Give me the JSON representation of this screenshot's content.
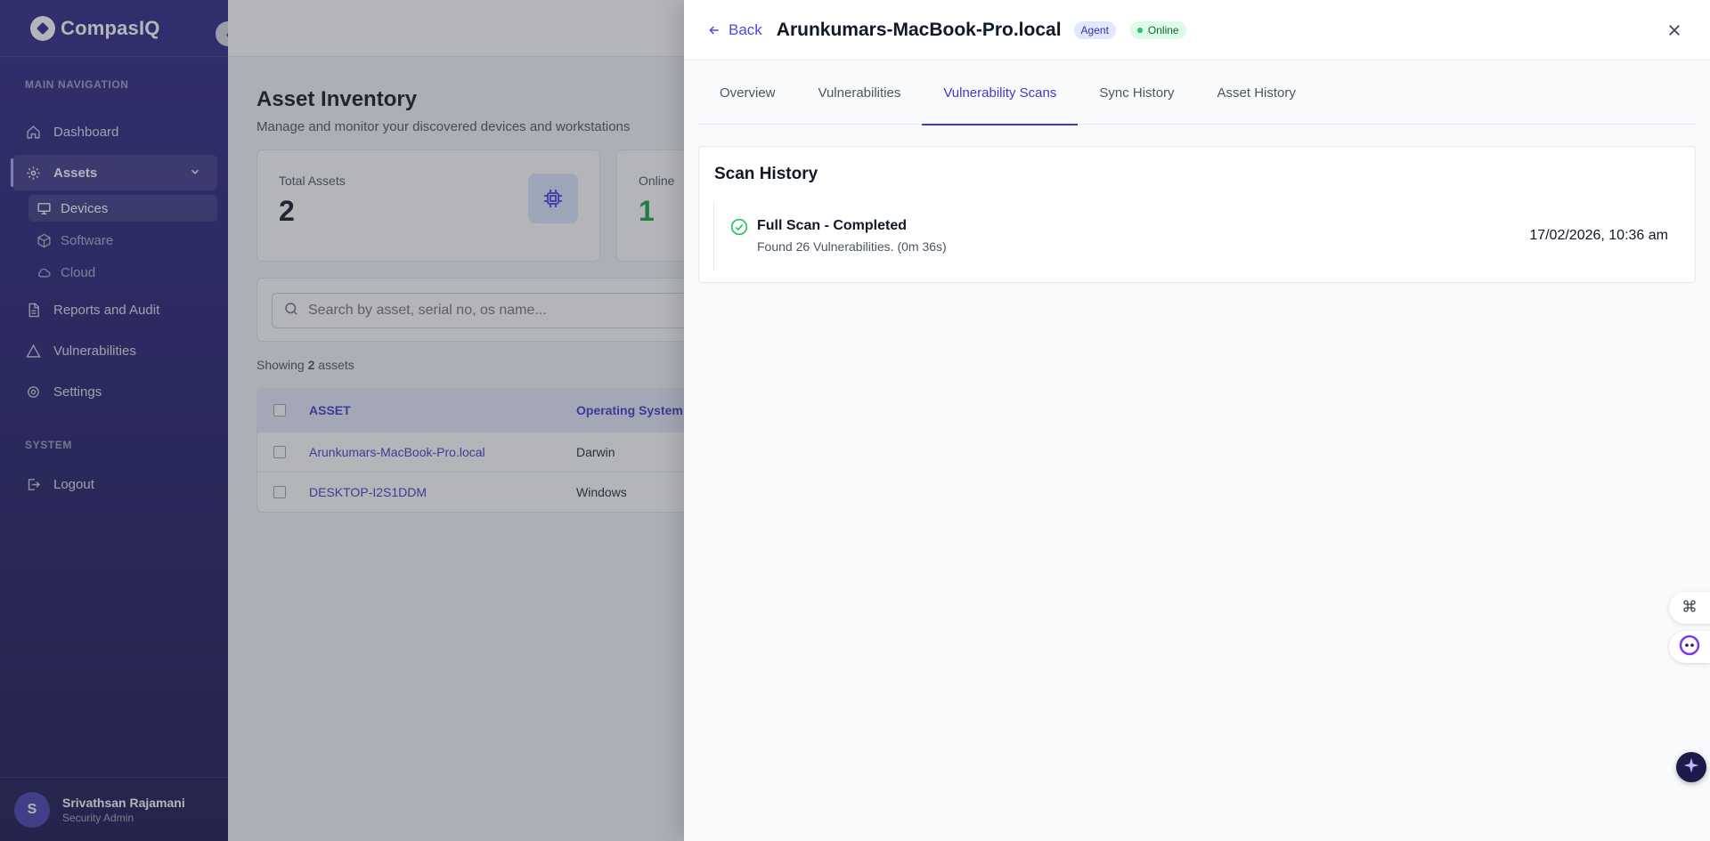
{
  "brand": {
    "name": "CompasIQ"
  },
  "sidebar": {
    "section_main": "MAIN NAVIGATION",
    "section_system": "SYSTEM",
    "items": {
      "dashboard": "Dashboard",
      "assets": "Assets",
      "devices": "Devices",
      "software": "Software",
      "cloud": "Cloud",
      "reports": "Reports and Audit",
      "vulnerabilities": "Vulnerabilities",
      "settings": "Settings",
      "logout": "Logout"
    },
    "user": {
      "initial": "S",
      "name": "Srivathsan Rajamani",
      "role": "Security Admin"
    }
  },
  "main": {
    "title": "Asset Inventory",
    "subtitle": "Manage and monitor your discovered devices and workstations",
    "stats": [
      {
        "label": "Total Assets",
        "value": "2"
      },
      {
        "label": "Online",
        "value": "1"
      }
    ],
    "search": {
      "placeholder": "Search by asset, serial no, os name..."
    },
    "showing": {
      "prefix": "Showing ",
      "count": "2",
      "suffix": " assets"
    },
    "table": {
      "headers": [
        "ASSET",
        "Operating System"
      ],
      "rows": [
        {
          "asset": "Arunkumars-MacBook-Pro.local",
          "os": "Darwin"
        },
        {
          "asset": "DESKTOP-I2S1DDM",
          "os": "Windows"
        }
      ]
    }
  },
  "drawer": {
    "back_label": "Back",
    "title": "Arunkumars-MacBook-Pro.local",
    "badge_type": "Agent",
    "badge_status": "Online",
    "tabs": [
      "Overview",
      "Vulnerabilities",
      "Vulnerability Scans",
      "Sync History",
      "Asset History"
    ],
    "active_tab": "Vulnerability Scans",
    "scan_history": {
      "title": "Scan History",
      "items": [
        {
          "name": "Full Scan - Completed",
          "description": "Found 26 Vulnerabilities. (0m 36s)",
          "date": "17/02/2026, 10:36 am",
          "status": "completed"
        }
      ]
    }
  },
  "colors": {
    "accent": "#4338ca",
    "success": "#22c55e",
    "sidebar": "#2e2784"
  }
}
